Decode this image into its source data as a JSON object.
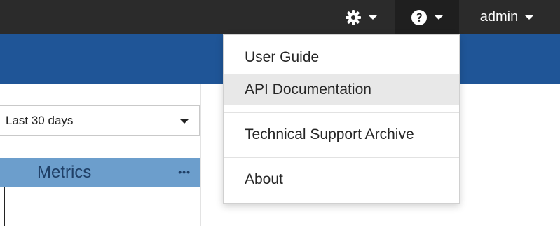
{
  "topbar": {
    "settings_icon": "gear-icon",
    "help_icon": "question-circle-icon",
    "user_label": "admin"
  },
  "filter": {
    "date_range_selected": "Last 30 days"
  },
  "metrics_panel": {
    "title": "Metrics",
    "more_glyph": "•••"
  },
  "help_menu": {
    "items": [
      {
        "label": "User Guide"
      },
      {
        "label": "API Documentation"
      },
      {
        "label": "Technical Support Archive"
      },
      {
        "label": "About"
      }
    ]
  },
  "colors": {
    "topbar_bg": "#2b2b2b",
    "banner_bg": "#1f5597",
    "metrics_header_bg": "#6c9ecc",
    "menu_hover_bg": "#e8e8e8"
  }
}
